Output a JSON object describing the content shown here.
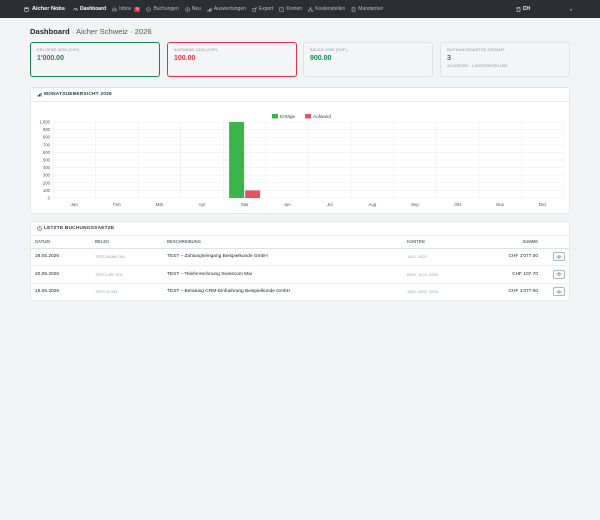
{
  "navbar": {
    "brand": "Aicher Nobs",
    "items": [
      {
        "label": "Dashboard",
        "icon": "gauge-icon",
        "active": true
      },
      {
        "label": "Inbox",
        "icon": "inbox-icon",
        "badge": "5"
      },
      {
        "label": "Buchungen",
        "icon": "list-icon"
      },
      {
        "label": "Neu",
        "icon": "plus-circle-icon"
      },
      {
        "label": "Auswertungen",
        "icon": "bar-chart-icon"
      },
      {
        "label": "Export",
        "icon": "export-icon"
      },
      {
        "label": "Konten",
        "icon": "book-icon"
      },
      {
        "label": "Kostenstellen",
        "icon": "diagram-icon"
      },
      {
        "label": "Mandanten",
        "icon": "building-icon"
      }
    ],
    "company": "CH"
  },
  "page": {
    "title": "Dashboard",
    "subtitle": "Aicher Schweiz · 2026"
  },
  "kpis": [
    {
      "label": "Erloese 2026 (CHF)",
      "value": "1'000.00",
      "color": "#198754"
    },
    {
      "label": "Aufwand 2026 (CHF)",
      "value": "100.00",
      "color": "#dc3545"
    },
    {
      "label": "Saldo 2026 (CHF)",
      "value": "900.00",
      "color": "#198754"
    },
    {
      "label": "Buchungssaetze gesamt",
      "value": "3",
      "sub": "41 Konten · 1 Kostenstellen"
    }
  ],
  "chart_card": {
    "title": "Monatsuebersicht 2026"
  },
  "chart_data": {
    "type": "bar",
    "categories": [
      "Jan",
      "Feb",
      "Mär",
      "Apr",
      "Mai",
      "Jun",
      "Jul",
      "Aug",
      "Sep",
      "Okt",
      "Nov",
      "Dez"
    ],
    "series": [
      {
        "name": "Erträge",
        "color": "#3cb44b",
        "values": [
          0,
          0,
          0,
          0,
          1000,
          0,
          0,
          0,
          0,
          0,
          0,
          0
        ]
      },
      {
        "name": "Aufwand",
        "color": "#e05560",
        "values": [
          0,
          0,
          0,
          0,
          100,
          0,
          0,
          0,
          0,
          0,
          0,
          0
        ]
      }
    ],
    "yticks": [
      "0",
      "100",
      "200",
      "300",
      "400",
      "500",
      "600",
      "700",
      "800",
      "900",
      "1.000"
    ],
    "ylim": [
      0,
      1000
    ],
    "legend": "top-center",
    "grid": true
  },
  "table_card": {
    "title": "Letzte Buchungssaetze",
    "columns": [
      "Datum",
      "Beleg",
      "Beschreibung",
      "Konten",
      "Summe"
    ],
    "rows": [
      {
        "datum": "28.05.2026",
        "beleg": "TEST-BANK-001",
        "beschreibung": "TEST – Zahlungseingang Beispielkunde GmbH",
        "konten": "1100, 1020",
        "summe": "CHF 1'077.00"
      },
      {
        "datum": "20.05.2026",
        "beleg": "TEST-LIEF-001",
        "beschreibung": "TEST – Telefonrechnung Swisscom Mai",
        "konten": "6510, 1170, 2000",
        "summe": "CHF 107.70"
      },
      {
        "datum": "15.05.2026",
        "beleg": "TEST-R-001",
        "beschreibung": "TEST – Beratung CRM-Einfuehrung Beispielkunde GmbH",
        "konten": "1100, 3400, 2200",
        "summe": "CHF 1'077.00"
      }
    ]
  }
}
